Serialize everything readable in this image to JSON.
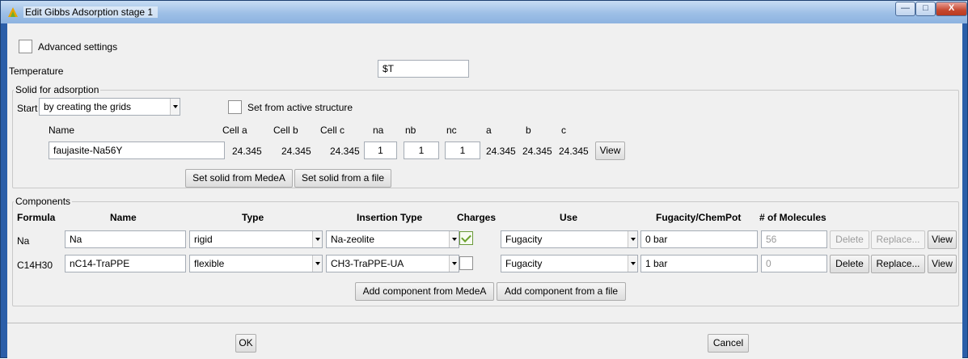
{
  "window": {
    "title": "Edit Gibbs Adsorption stage 1",
    "minimize": "—",
    "maximize": "□",
    "close": "X"
  },
  "advanced": {
    "label": "Advanced settings",
    "checked": false
  },
  "temperature": {
    "label": "Temperature",
    "value": "$T"
  },
  "solid": {
    "group_title": "Solid for adsorption",
    "start_label": "Start",
    "start_value": "by creating the grids",
    "set_active_label": "Set from active structure",
    "headers": {
      "name": "Name",
      "cell_a": "Cell a",
      "cell_b": "Cell b",
      "cell_c": "Cell c",
      "na": "na",
      "nb": "nb",
      "nc": "nc",
      "a": "a",
      "b": "b",
      "c": "c"
    },
    "name": "faujasite-Na56Y",
    "cell_a": "24.345",
    "cell_b": "24.345",
    "cell_c": "24.345",
    "na": "1",
    "nb": "1",
    "nc": "1",
    "a": "24.345",
    "b": "24.345",
    "c": "24.345",
    "view_label": "View",
    "set_medea_label": "Set solid from MedeA",
    "set_file_label": "Set solid from a file"
  },
  "components": {
    "group_title": "Components",
    "headers": {
      "formula": "Formula",
      "name": "Name",
      "type": "Type",
      "insertion": "Insertion Type",
      "charges": "Charges",
      "use": "Use",
      "fugacity": "Fugacity/ChemPot",
      "molecules": "# of Molecules"
    },
    "rows": [
      {
        "formula": "Na",
        "name": "Na",
        "type": "rigid",
        "insertion": "Na-zeolite",
        "charges": true,
        "use": "Fugacity",
        "fugacity": "0 bar",
        "molecules": "56",
        "delete": "Delete",
        "replace": "Replace...",
        "view": "View",
        "enabled": false
      },
      {
        "formula": "C14H30",
        "name": "nC14-TraPPE",
        "type": "flexible",
        "insertion": "CH3-TraPPE-UA",
        "charges": false,
        "use": "Fugacity",
        "fugacity": "1 bar",
        "molecules": "0",
        "delete": "Delete",
        "replace": "Replace...",
        "view": "View",
        "enabled": true
      }
    ],
    "add_medea_label": "Add component from MedeA",
    "add_file_label": "Add component from a file"
  },
  "buttons": {
    "ok": "OK",
    "cancel": "Cancel"
  }
}
